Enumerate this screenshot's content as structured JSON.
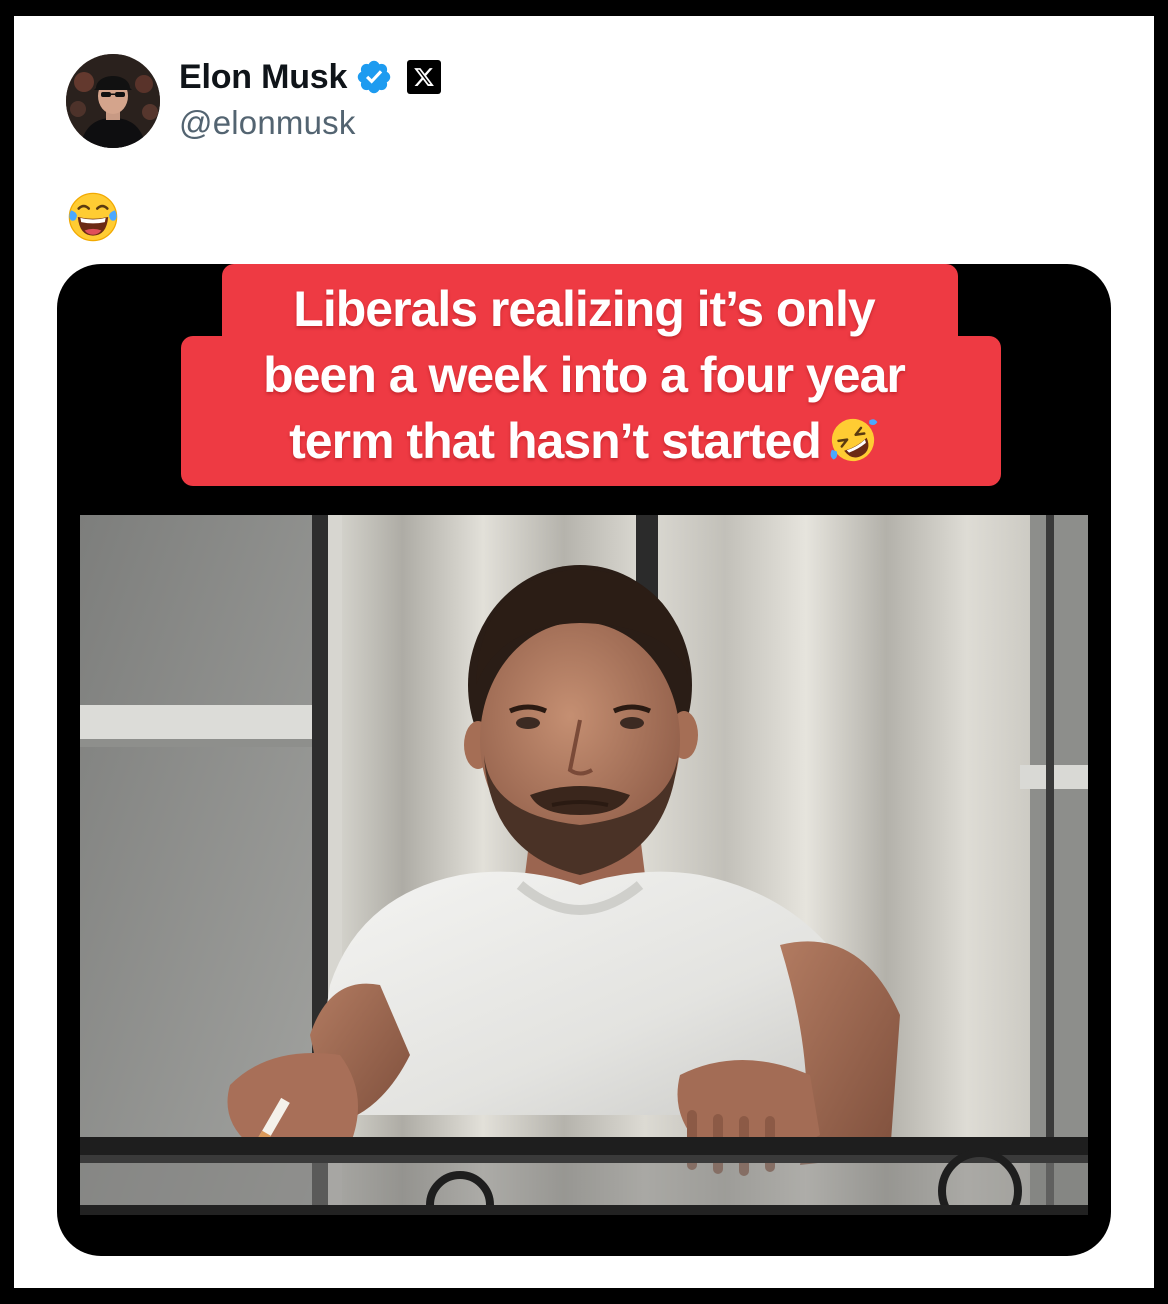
{
  "tweet": {
    "author": {
      "display_name": "Elon Musk",
      "handle": "@elonmusk",
      "verified_icon": "verified-badge-icon",
      "affiliation_icon": "x-logo-icon"
    },
    "text": "😂",
    "text_icon": "tears-of-joy-emoji-icon",
    "media": {
      "caption_lines": [
        "Liberals realizing it’s only",
        "been a week into a four year",
        "term that hasn’t started"
      ],
      "caption_emoji": "rolling-on-floor-laughing-emoji-icon",
      "photo_icon": "man-on-balcony-smoking-photo"
    }
  },
  "colors": {
    "caption_red": "#ee3a43",
    "verified_blue": "#1d9bf0",
    "name_text": "#0f1419",
    "handle_text": "#536471"
  }
}
